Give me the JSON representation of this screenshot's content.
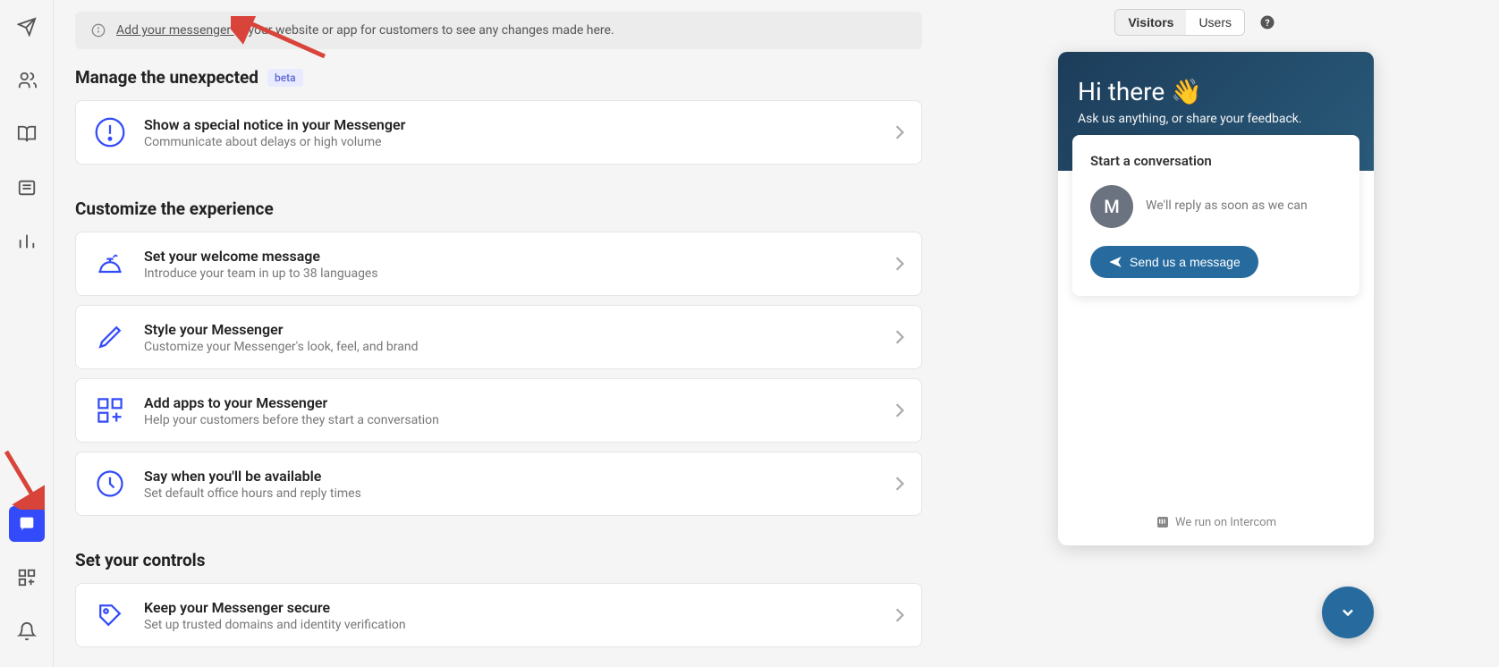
{
  "notice": {
    "link_text": "Add your messenger ",
    "rest": "to your website or app for customers to see any changes made here."
  },
  "sections": {
    "manage": {
      "title": "Manage the unexpected",
      "badge": "beta"
    },
    "customize": {
      "title": "Customize the experience"
    },
    "controls": {
      "title": "Set your controls"
    }
  },
  "cards": {
    "notice_card": {
      "title": "Show a special notice in your Messenger",
      "subtitle": "Communicate about delays or high volume"
    },
    "welcome": {
      "title": "Set your welcome message",
      "subtitle": "Introduce your team in up to 38 languages"
    },
    "style": {
      "title": "Style your Messenger",
      "subtitle": "Customize your Messenger's look, feel, and brand"
    },
    "apps": {
      "title": "Add apps to your Messenger",
      "subtitle": "Help your customers before they start a conversation"
    },
    "available": {
      "title": "Say when you'll be available",
      "subtitle": "Set default office hours and reply times"
    },
    "secure": {
      "title": "Keep your Messenger secure",
      "subtitle": "Set up trusted domains and identity verification"
    }
  },
  "toggle": {
    "visitors": "Visitors",
    "users": "Users"
  },
  "preview": {
    "greeting": "Hi there 👋",
    "tagline": "Ask us anything, or share your feedback.",
    "start_title": "Start a conversation",
    "avatar_letter": "M",
    "reply_text": "We'll reply as soon as we can",
    "send_label": "Send us a message",
    "footer": "We run on Intercom"
  }
}
